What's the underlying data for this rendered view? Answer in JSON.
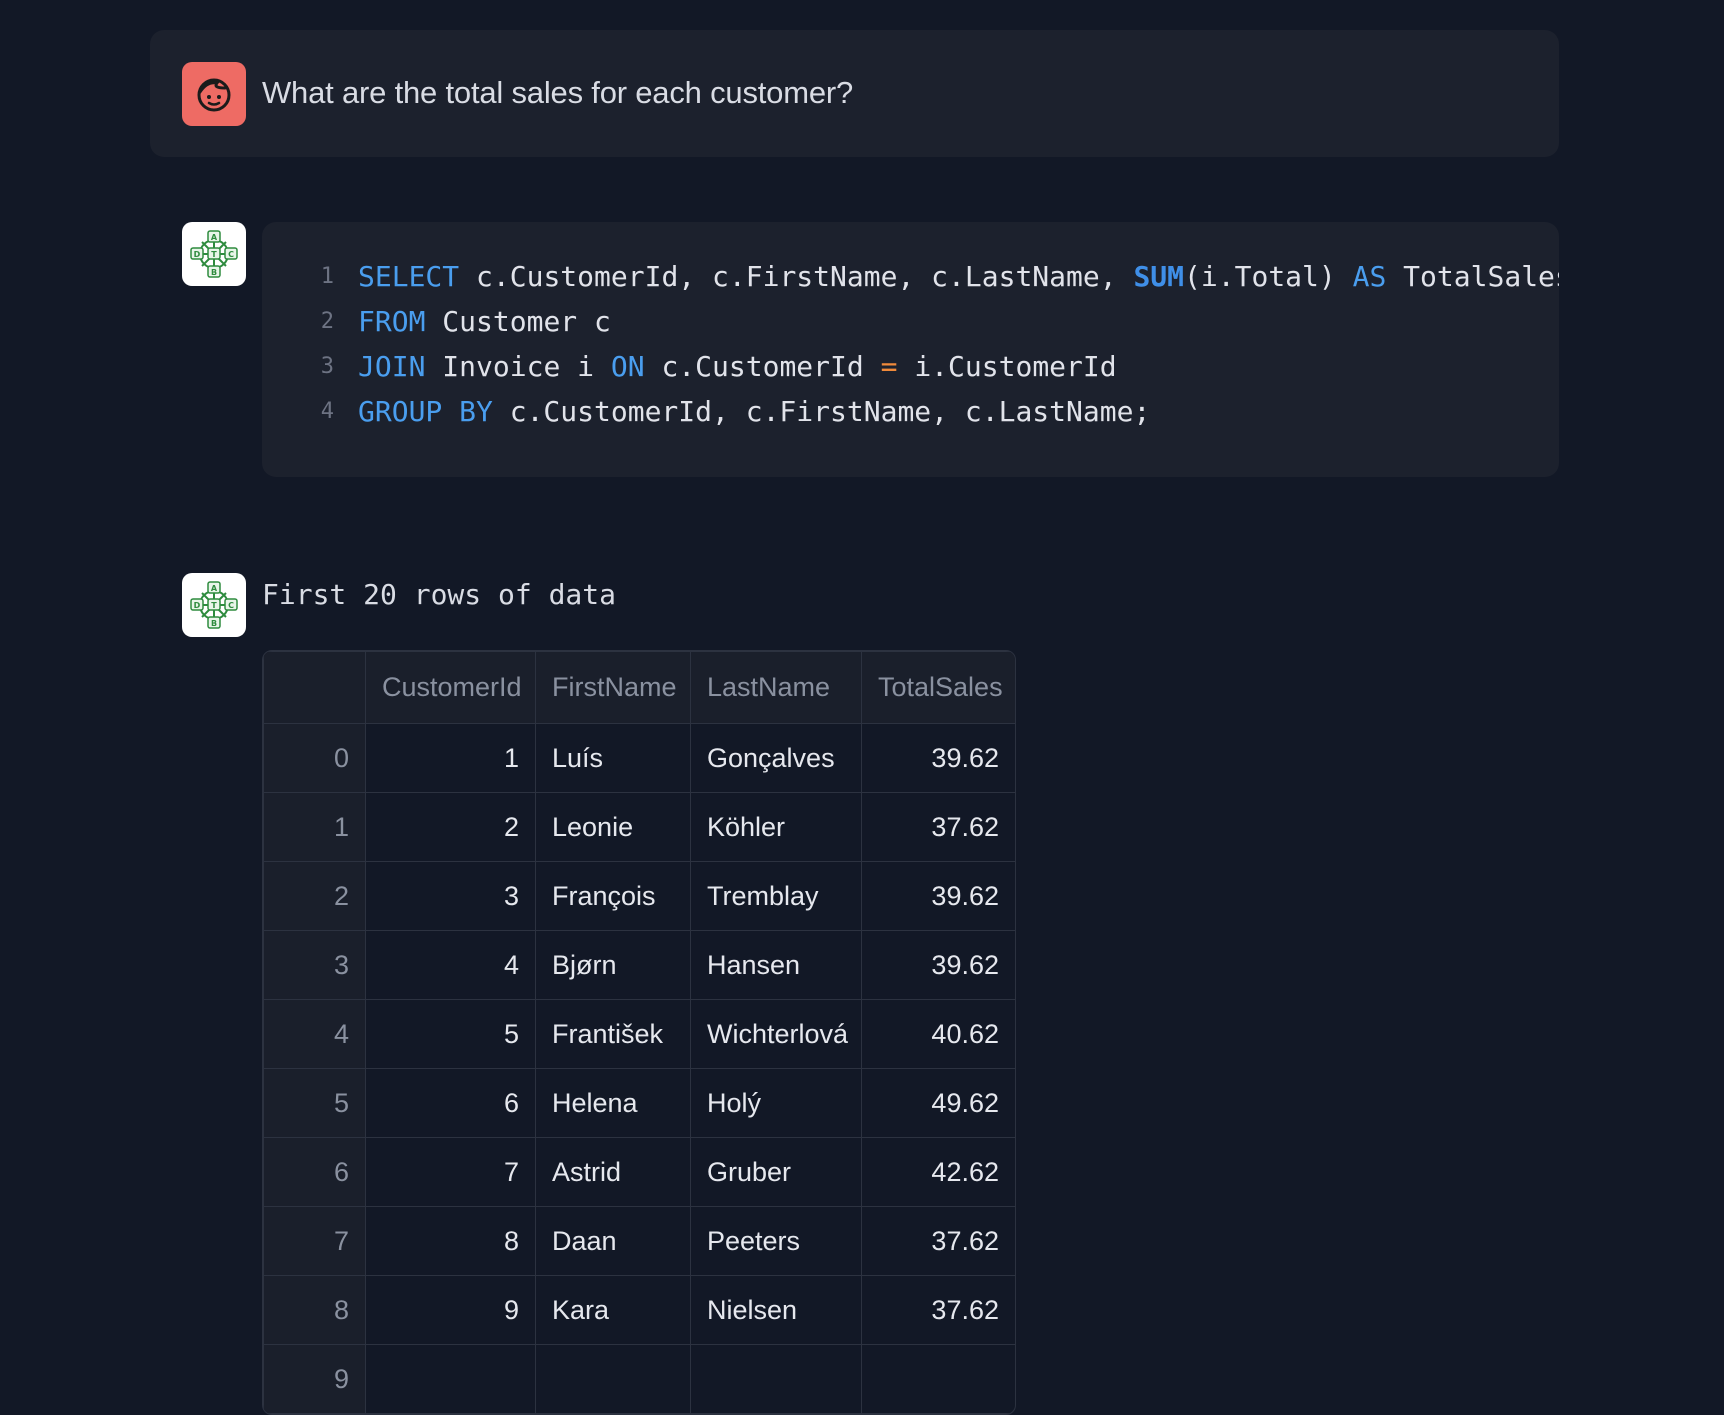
{
  "user_message": {
    "avatar_icon": "face-icon",
    "text": "What are the total sales for each customer?"
  },
  "assistant": {
    "avatar_icon": "abcd-graph-logo-icon",
    "code": {
      "lines": [
        {
          "no": "1",
          "tokens": [
            {
              "t": "SELECT",
              "c": "kw"
            },
            {
              "t": " c.CustomerId, c.FirstName, c.LastName, ",
              "c": ""
            },
            {
              "t": "SUM",
              "c": "fn"
            },
            {
              "t": "(i.Total) ",
              "c": ""
            },
            {
              "t": "AS",
              "c": "kw"
            },
            {
              "t": " TotalSales",
              "c": ""
            }
          ]
        },
        {
          "no": "2",
          "tokens": [
            {
              "t": "FROM",
              "c": "kw"
            },
            {
              "t": " Customer c",
              "c": ""
            }
          ]
        },
        {
          "no": "3",
          "tokens": [
            {
              "t": "JOIN",
              "c": "kw"
            },
            {
              "t": " Invoice i ",
              "c": ""
            },
            {
              "t": "ON",
              "c": "kw"
            },
            {
              "t": " c.CustomerId ",
              "c": ""
            },
            {
              "t": "=",
              "c": "op"
            },
            {
              "t": " i.CustomerId",
              "c": ""
            }
          ]
        },
        {
          "no": "4",
          "tokens": [
            {
              "t": "GROUP BY",
              "c": "kw"
            },
            {
              "t": " c.CustomerId, c.FirstName, c.LastName;",
              "c": ""
            }
          ]
        }
      ]
    },
    "caption": "First 20 rows of data",
    "table": {
      "columns": [
        "",
        "CustomerId",
        "FirstName",
        "LastName",
        "TotalSales"
      ],
      "rows": [
        [
          "0",
          "1",
          "Luís",
          "Gonçalves",
          "39.62"
        ],
        [
          "1",
          "2",
          "Leonie",
          "Köhler",
          "37.62"
        ],
        [
          "2",
          "3",
          "François",
          "Tremblay",
          "39.62"
        ],
        [
          "3",
          "4",
          "Bjørn",
          "Hansen",
          "39.62"
        ],
        [
          "4",
          "5",
          "František",
          "Wichterlová",
          "40.62"
        ],
        [
          "5",
          "6",
          "Helena",
          "Holý",
          "49.62"
        ],
        [
          "6",
          "7",
          "Astrid",
          "Gruber",
          "42.62"
        ],
        [
          "7",
          "8",
          "Daan",
          "Peeters",
          "37.62"
        ],
        [
          "8",
          "9",
          "Kara",
          "Nielsen",
          "37.62"
        ],
        [
          "9",
          "",
          "",
          "",
          ""
        ]
      ]
    }
  },
  "colors": {
    "background": "#121826",
    "card": "#1c212d",
    "user_avatar": "#ee6b64",
    "keyword": "#4a9eef",
    "operator": "#f08a3a",
    "logo_green": "#2e8b3e"
  }
}
